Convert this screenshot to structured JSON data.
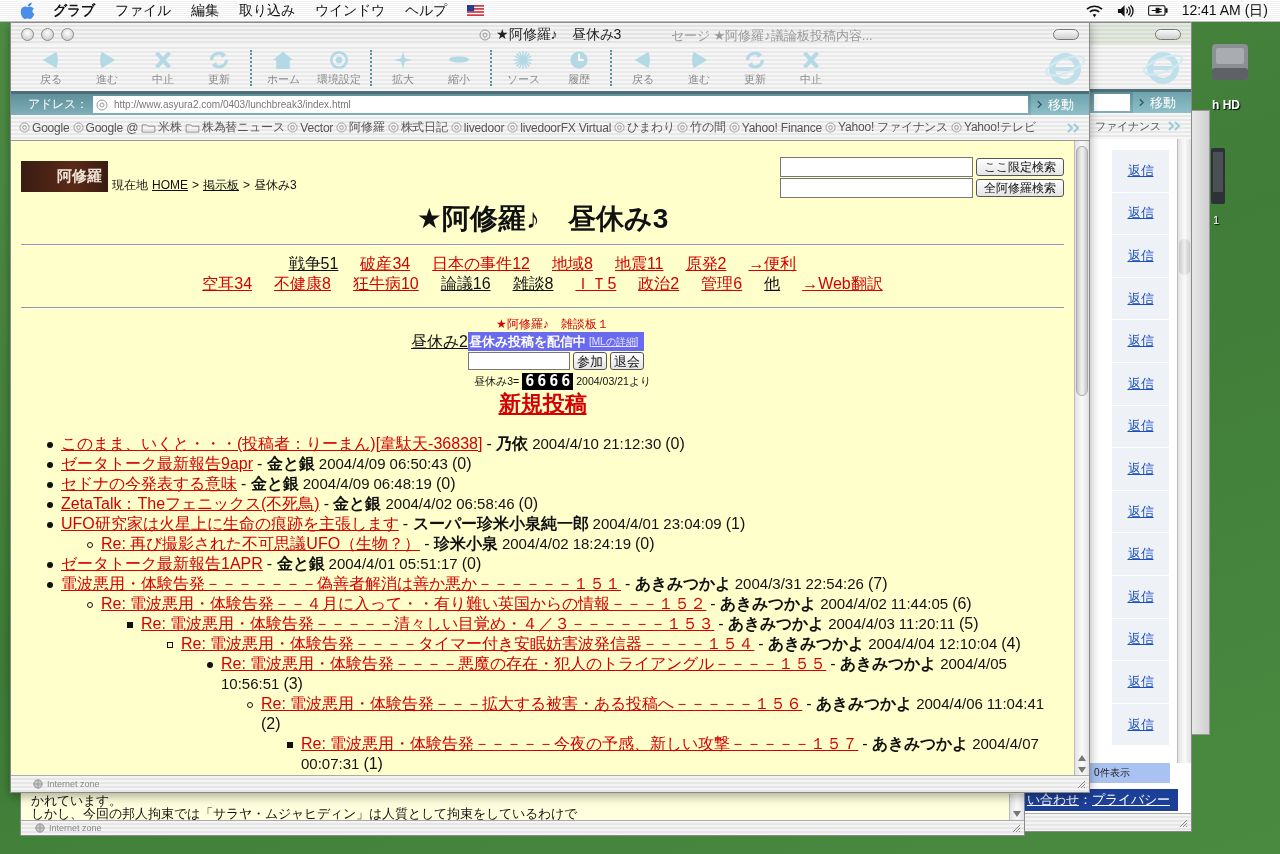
{
  "menu_bar": {
    "app_name": "グラブ",
    "menus": [
      "ファイル",
      "編集",
      "取り込み",
      "ウインドウ",
      "ヘルプ"
    ],
    "clock": "12:41 AM (日)"
  },
  "desktop_icons": [
    {
      "label": "h HD",
      "kind": "drive"
    },
    {
      "label": "1",
      "kind": "device"
    }
  ],
  "back_window_right": {
    "title": "セージ ★阿修羅♪議論板投稿内容...",
    "go_button": "移動",
    "favorite": "ファイナンス",
    "reply_links": [
      "返信",
      "返信",
      "返信",
      "返信",
      "返信",
      "返信",
      "返信",
      "返信",
      "返信",
      "返信",
      "返信",
      "返信",
      "返信",
      "返信"
    ],
    "footer_count": "0件表示",
    "footer_links": [
      {
        "text": "い合わせ",
        "link": true
      },
      {
        "text": "：",
        "link": false
      },
      {
        "text": "プライバシー",
        "link": true
      }
    ]
  },
  "back_window_bottom": {
    "lines": [
      "かれています。",
      "しかし、今回の邦人拘束では「サラヤ・ムジャヒディン」は人質として拘束をしているわけで"
    ],
    "status": "Internet zone"
  },
  "browser": {
    "title": "★阿修羅♪　昼休み3",
    "toolbar_groups": [
      {
        "buttons": [
          {
            "label": "戻る",
            "kind": "back"
          },
          {
            "label": "進む",
            "kind": "forward"
          },
          {
            "label": "中止",
            "kind": "stop"
          },
          {
            "label": "更新",
            "kind": "refresh"
          }
        ]
      },
      {
        "buttons": [
          {
            "label": "ホーム",
            "kind": "home"
          },
          {
            "label": "環境設定",
            "kind": "prefs"
          }
        ]
      },
      {
        "buttons": [
          {
            "label": "拡大",
            "kind": "larger"
          },
          {
            "label": "縮小",
            "kind": "smaller"
          }
        ]
      },
      {
        "buttons": [
          {
            "label": "ソース",
            "kind": "source"
          },
          {
            "label": "履歴",
            "kind": "history"
          }
        ]
      },
      {
        "buttons": [
          {
            "label": "戻る",
            "kind": "back"
          },
          {
            "label": "進む",
            "kind": "forward"
          },
          {
            "label": "更新",
            "kind": "refresh"
          },
          {
            "label": "中止",
            "kind": "stop"
          }
        ]
      }
    ],
    "address": {
      "label": "アドレス：",
      "url": "http://www.asyura2.com/0403/lunchbreak3/index.html",
      "go_button": "移動"
    },
    "favorites": [
      {
        "label": "Google",
        "kind": "page"
      },
      {
        "label": "Google @",
        "kind": "page"
      },
      {
        "label": "米株",
        "kind": "folder"
      },
      {
        "label": "株為替ニュース",
        "kind": "folder"
      },
      {
        "label": "Vector",
        "kind": "page"
      },
      {
        "label": "阿修羅",
        "kind": "page"
      },
      {
        "label": "株式日記",
        "kind": "page"
      },
      {
        "label": "livedoor",
        "kind": "page"
      },
      {
        "label": "livedoorFX Virtual",
        "kind": "page"
      },
      {
        "label": "ひまわり",
        "kind": "page"
      },
      {
        "label": "竹の間",
        "kind": "page"
      },
      {
        "label": "Yahoo! Finance",
        "kind": "page"
      },
      {
        "label": "Yahoo! ファイナンス",
        "kind": "page"
      },
      {
        "label": "Yahoo!テレビ",
        "kind": "page"
      }
    ],
    "status": "Internet zone"
  },
  "page": {
    "logo": "阿修羅",
    "breadcrumb": [
      {
        "text": "現在地",
        "link": false
      },
      {
        "text": "HOME",
        "link": true
      },
      {
        "text": ">",
        "link": false
      },
      {
        "text": "掲示板",
        "link": true
      },
      {
        "text": ">",
        "link": false
      },
      {
        "text": "昼休み3",
        "link": false
      }
    ],
    "search": [
      {
        "button": "ここ限定検索"
      },
      {
        "button": "全阿修羅検索"
      }
    ],
    "title": "★阿修羅♪　昼休み3",
    "nav_rows": [
      [
        {
          "label": "戦争51",
          "visited": true
        },
        {
          "label": "破産34",
          "visited": false
        },
        {
          "label": "日本の事件12",
          "visited": false
        },
        {
          "label": "地域8",
          "visited": false
        },
        {
          "label": "地震11",
          "visited": false
        },
        {
          "label": "原発2",
          "visited": false
        },
        {
          "label": "→便利",
          "visited": false
        }
      ],
      [
        {
          "label": "空耳34",
          "visited": false
        },
        {
          "label": "不健康8",
          "visited": false
        },
        {
          "label": "狂牛病10",
          "visited": false
        },
        {
          "label": "論議16",
          "visited": true
        },
        {
          "label": "雑談8",
          "visited": true
        },
        {
          "label": "ＩＴ5",
          "visited": false
        },
        {
          "label": "政治2",
          "visited": false
        },
        {
          "label": "管理6",
          "visited": false
        },
        {
          "label": "他",
          "visited": true
        },
        {
          "label": "→Web翻訳",
          "visited": false
        }
      ]
    ],
    "board_link": "★阿修羅♪　雑談板１",
    "prev_link": "昼休み2",
    "mailing_list": {
      "title": "昼休み投稿を配信中",
      "detail": "[MLの詳細]",
      "buttons": [
        "参加",
        "退会"
      ]
    },
    "counter": {
      "label": "昼休み3=",
      "digits": "6666",
      "since": "2004/03/21より"
    },
    "new_post": "新規投稿",
    "threads": [
      {
        "title": "このまま、いくと・・・(投稿者：りーまん)[韋駄天-36838]",
        "byline": "- **乃依**",
        "date": "2004/4/10",
        "time": "21:12:30",
        "replies": "(0)"
      },
      {
        "title": "ゼータトーク最新報告9apr",
        "byline": "- **金と銀**",
        "date": "2004/4/09",
        "time": "06:50:43",
        "replies": "(0)"
      },
      {
        "title": "セドナの今発表する意味",
        "byline": "- **金と銀**",
        "date": "2004/4/09",
        "time": "06:48:19",
        "replies": "(0)"
      },
      {
        "title": "ZetaTalk：Theフェニックス(不死鳥)",
        "byline": "- **金と銀**",
        "date": "2004/4/02",
        "time": "06:58:46",
        "replies": "(0)"
      },
      {
        "title": "UFO研究家は火星上に生命の痕跡を主張します",
        "byline": "- **スーパー珍米小泉純一郎**",
        "date": "2004/4/01",
        "time": "23:04:09",
        "replies": "(1)",
        "children": [
          {
            "title": "Re: 再び撮影された不可思議UFO（生物？）",
            "byline": "- **珍米小泉**",
            "date": "2004/4/02",
            "time": "18:24:19",
            "replies": "(0)"
          }
        ]
      },
      {
        "title": "ゼータトーク最新報告1APR",
        "byline": "- **金と銀**",
        "date": "2004/4/01",
        "time": "05:51:17",
        "replies": "(0)"
      },
      {
        "title": "電波悪用・体験告発－－－－－－－偽善者解消は善か悪か－－－－－－１５１",
        "byline": "- **あきみつかよ**",
        "date": "2004/3/31",
        "time": "22:54:26",
        "replies": "(7)",
        "children": [
          {
            "title": "Re: 電波悪用・体験告発－－４月に入って・・有り難い英国からの情報－－－１５２",
            "byline": "- **あきみつかよ**",
            "date": "2004/4/02",
            "time": "11:44:05",
            "replies": "(6)",
            "children": [
              {
                "title": "Re: 電波悪用・体験告発－－－－－清々しい目覚め・４／３－－－－－－１５３",
                "byline": "- **あきみつかよ**",
                "date": "2004/4/03",
                "time": "11:20:11",
                "replies": "(5)",
                "children": [
                  {
                    "title": "Re: 電波悪用・体験告発－－－－タイマー付き安眠妨害波発信器－－－－１５４",
                    "byline": "- **あきみつかよ**",
                    "date": "2004/4/04",
                    "time": "12:10:04",
                    "replies": "(4)",
                    "children": [
                      {
                        "title": "Re: 電波悪用・体験告発－－－－悪魔の存在・犯人のトライアングル－－－－１５５",
                        "byline": "- **あきみつかよ**",
                        "date": "2004/4/05",
                        "time": "10:56:51",
                        "replies": "(3)",
                        "children": [
                          {
                            "title": "Re: 電波悪用・体験告発－－－拡大する被害・ある投稿へ－－－－－１５６",
                            "byline": "- **あきみつかよ**",
                            "date": "2004/4/06",
                            "time": "11:04:41",
                            "replies": "(2)",
                            "children": [
                              {
                                "title": "Re: 電波悪用・体験告発－－－－－今夜の予感、新しい攻撃－－－－－１５７",
                                "byline": "- **あきみつかよ**",
                                "date": "2004/4/07",
                                "time": "00:07:31",
                                "replies": "(1)"
                              }
                            ]
                          }
                        ]
                      }
                    ]
                  }
                ]
              }
            ]
          }
        ]
      }
    ]
  }
}
